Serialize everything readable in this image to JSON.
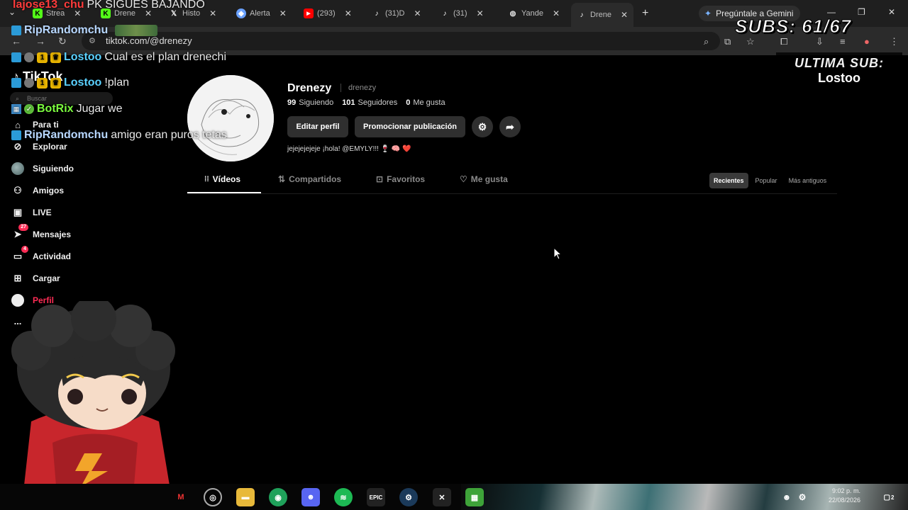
{
  "browser": {
    "tabs": [
      {
        "label": "Strea",
        "icon": "kick-icon",
        "color": "#53fc18"
      },
      {
        "label": "Drene",
        "icon": "kick-icon",
        "color": "#53fc18"
      },
      {
        "label": "Histo",
        "icon": "x-icon",
        "color": "#ffffff"
      },
      {
        "label": "Alerta",
        "icon": "alert-icon",
        "color": "#6aa1ff"
      },
      {
        "label": "(293)",
        "icon": "youtube-icon",
        "color": "#ff0000"
      },
      {
        "label": "(31)D",
        "icon": "tiktok-icon",
        "color": "#ffffff"
      },
      {
        "label": "(31)",
        "icon": "tiktok-icon",
        "color": "#ffffff"
      },
      {
        "label": "Yande",
        "icon": "globe-icon",
        "color": "#ffffff"
      },
      {
        "label": "Drene",
        "icon": "tiktok-icon",
        "color": "#ffffff",
        "active": true
      }
    ],
    "gemini_label": "Pregúntale a Gemini",
    "url": "tiktok.com/@drenezy"
  },
  "tiktok": {
    "logo": "TikTok",
    "search_placeholder": "Buscar",
    "nav": [
      {
        "label": "Para ti",
        "icon": "home-icon"
      },
      {
        "label": "Explorar",
        "icon": "compass-icon"
      },
      {
        "label": "Siguiendo",
        "icon": "following-icon"
      },
      {
        "label": "Amigos",
        "icon": "friends-icon"
      },
      {
        "label": "LIVE",
        "icon": "live-icon"
      },
      {
        "label": "Mensajes",
        "icon": "messages-icon",
        "badge": "27"
      },
      {
        "label": "Actividad",
        "icon": "activity-icon",
        "badge": "4"
      },
      {
        "label": "Cargar",
        "icon": "upload-icon"
      },
      {
        "label": "Perfil",
        "icon": "profile-icon",
        "active": true
      },
      {
        "label": "...",
        "icon": "more-icon"
      }
    ],
    "profile": {
      "name": "Drenezy",
      "handle": "drenezy",
      "following_count": "99",
      "following_label": "Siguiendo",
      "followers_count": "101",
      "followers_label": "Seguidores",
      "likes_count": "0",
      "likes_label": "Me gusta",
      "edit_label": "Editar perfil",
      "promote_label": "Promocionar publicación",
      "bio": "jejejejejeje ¡hola! @EMYLY!!! 🍷 🧠 ❤️"
    },
    "tabs": [
      "Vídeos",
      "Compartidos",
      "Favoritos",
      "Me gusta"
    ],
    "sort": [
      "Recientes",
      "Popular",
      "Más antiguos"
    ]
  },
  "overlay": {
    "chat": [
      {
        "user": "lajose13_chu",
        "msg": "PK SIGUES BAJANDO",
        "color": "#ff3b3b"
      },
      {
        "user": "RipRandomchu",
        "msg": "",
        "color": "#b7d7ff"
      },
      {
        "user": "Lostoo",
        "msg": "Cual es el plan drenechi",
        "color": "#5ad1ff"
      },
      {
        "user": "Lostoo",
        "msg": "!plan",
        "color": "#5ad1ff"
      },
      {
        "user": "BotRix",
        "msg": "Jugar we",
        "color": "#7cff3f"
      },
      {
        "user": "RipRandomchu",
        "msg": "amigo eran puros tetas",
        "color": "#b7d7ff"
      }
    ],
    "subs_text": "SUBS: 61/67",
    "last_sub_title": "ULTIMA SUB:",
    "last_sub_value": "Lostoo"
  },
  "taskbar": {
    "time": "9:02 p. m.",
    "date": "22/08/2026",
    "notifications": "2"
  }
}
